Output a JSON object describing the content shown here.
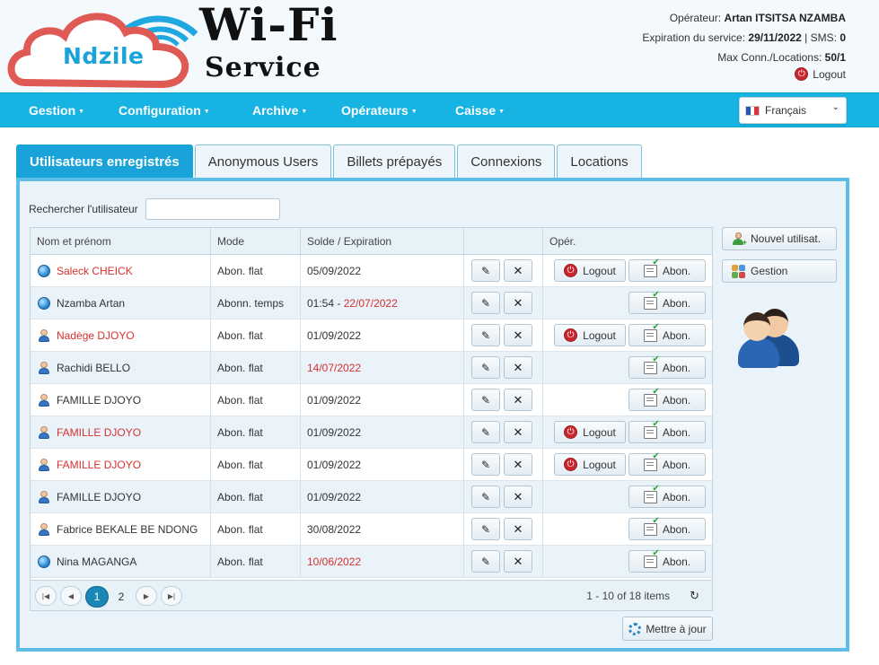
{
  "brand": {
    "logo_word": "Ndzile",
    "title": "Wi-Fi",
    "subtitle": "Service"
  },
  "operator": {
    "label": "Opérateur:",
    "name": "Artan ITSITSA NZAMBA",
    "expiration_label": "Expiration du service:",
    "expiration": "29/11/2022",
    "sep": "|",
    "sms_label": "SMS:",
    "sms": "0",
    "max_label": "Max Conn./Locations:",
    "max": "50/1",
    "logout": "Logout"
  },
  "nav": {
    "items": [
      "Gestion",
      "Configuration",
      "Archive",
      "Opérateurs",
      "Caisse"
    ],
    "language": "Français"
  },
  "tabs": [
    "Utilisateurs enregistrés",
    "Anonymous Users",
    "Billets prépayés",
    "Connexions",
    "Locations"
  ],
  "search": {
    "label": "Rechercher l'utilisateur",
    "value": ""
  },
  "table": {
    "headers": [
      "Nom et prénom",
      "Mode",
      "Solde / Expiration",
      "",
      "Opér."
    ],
    "rows": [
      {
        "name": "Saleck CHEICK",
        "name_red": true,
        "icon": "globe-icon",
        "mode": "Abon. flat",
        "solde_prefix": "",
        "solde": "05/09/2022",
        "solde_red": false,
        "logout": "Logout",
        "abon": "Abon."
      },
      {
        "name": "Nzamba Artan",
        "name_red": false,
        "icon": "globe-icon",
        "mode": "Abonn. temps",
        "solde_prefix": "01:54 - ",
        "solde": "22/07/2022",
        "solde_red": true,
        "logout": "",
        "abon": "Abon."
      },
      {
        "name": "Nadège DJOYO",
        "name_red": true,
        "icon": "user-icon",
        "mode": "Abon. flat",
        "solde_prefix": "",
        "solde": "01/09/2022",
        "solde_red": false,
        "logout": "Logout",
        "abon": "Abon."
      },
      {
        "name": "Rachidi BELLO",
        "name_red": false,
        "icon": "user-icon",
        "mode": "Abon. flat",
        "solde_prefix": "",
        "solde": "14/07/2022",
        "solde_red": true,
        "logout": "",
        "abon": "Abon."
      },
      {
        "name": "FAMILLE DJOYO",
        "name_red": false,
        "icon": "user-icon",
        "mode": "Abon. flat",
        "solde_prefix": "",
        "solde": "01/09/2022",
        "solde_red": false,
        "logout": "",
        "abon": "Abon."
      },
      {
        "name": "FAMILLE DJOYO",
        "name_red": true,
        "icon": "user-icon",
        "mode": "Abon. flat",
        "solde_prefix": "",
        "solde": "01/09/2022",
        "solde_red": false,
        "logout": "Logout",
        "abon": "Abon."
      },
      {
        "name": "FAMILLE DJOYO",
        "name_red": true,
        "icon": "user-icon",
        "mode": "Abon. flat",
        "solde_prefix": "",
        "solde": "01/09/2022",
        "solde_red": false,
        "logout": "Logout",
        "abon": "Abon."
      },
      {
        "name": "FAMILLE DJOYO",
        "name_red": false,
        "icon": "user-icon",
        "mode": "Abon. flat",
        "solde_prefix": "",
        "solde": "01/09/2022",
        "solde_red": false,
        "logout": "",
        "abon": "Abon."
      },
      {
        "name": "Fabrice BEKALE BE NDONG",
        "name_red": false,
        "icon": "user-icon",
        "mode": "Abon. flat",
        "solde_prefix": "",
        "solde": "30/08/2022",
        "solde_red": false,
        "logout": "",
        "abon": "Abon."
      },
      {
        "name": "Nina MAGANGA",
        "name_red": false,
        "icon": "globe-icon",
        "mode": "Abon. flat",
        "solde_prefix": "",
        "solde": "10/06/2022",
        "solde_red": true,
        "logout": "",
        "abon": "Abon."
      }
    ]
  },
  "pager": {
    "pages": [
      "1",
      "2"
    ],
    "current": "1",
    "info": "1 - 10 of 18 items"
  },
  "actions": {
    "update": "Mettre à jour",
    "new_user": "Nouvel utilisat.",
    "manage": "Gestion"
  },
  "colors": {
    "accent": "#16b3e3",
    "tab_active": "#1aa3d9",
    "alert_red": "#d9302f"
  }
}
